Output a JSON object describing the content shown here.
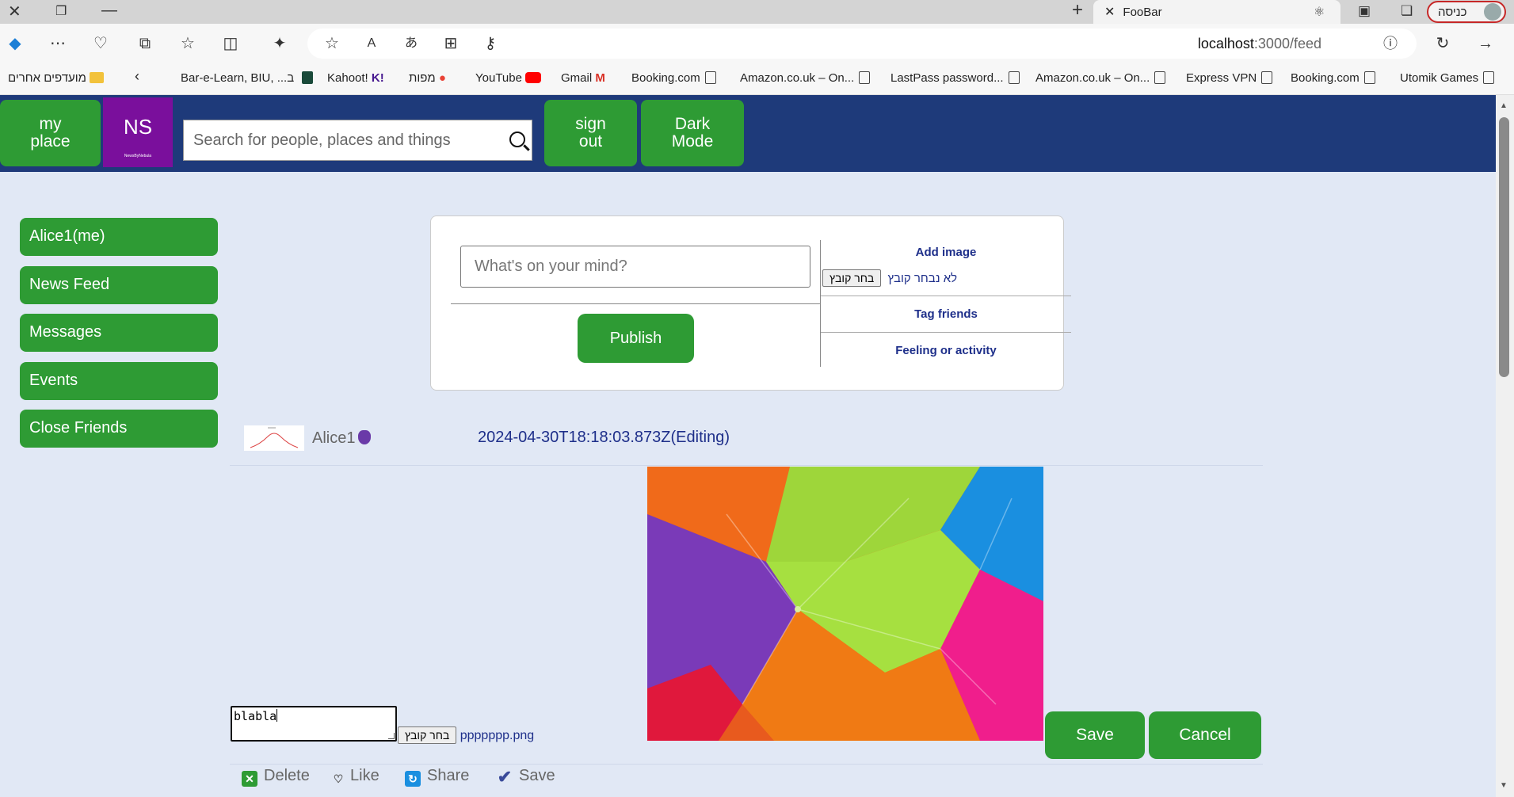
{
  "browser": {
    "tab_title": "FooBar",
    "profile_label": "כניסה",
    "url_host": "localhost",
    "url_port_path": ":3000/feed",
    "bookmarks": [
      "מועדפים אחרים",
      "Bar-e-Learn, BIU, ...ב",
      "Kahoot!",
      "מפות",
      "YouTube",
      "Gmail",
      "Booking.com",
      "Amazon.co.uk – On...",
      "LastPass password...",
      "Amazon.co.uk – On...",
      "Express VPN",
      "Booking.com",
      "Utomik Games"
    ]
  },
  "header": {
    "my_place": "my place",
    "logo_text": "NS",
    "logo_small": "NewsByNebula",
    "search_placeholder": "Search for people, places and things",
    "sign_out": "sign out",
    "dark_mode": "Dark Mode"
  },
  "sidebar": {
    "items": [
      {
        "label": "Alice1(me)"
      },
      {
        "label": "News Feed"
      },
      {
        "label": "Messages"
      },
      {
        "label": "Events"
      },
      {
        "label": "Close Friends"
      }
    ]
  },
  "composer": {
    "placeholder": "What's on your mind?",
    "publish": "Publish",
    "add_image": "Add image",
    "choose_file": "בחר קובץ",
    "no_file": "לא נבחר קובץ",
    "tag_friends": "Tag friends",
    "feeling": "Feeling or activity"
  },
  "post": {
    "author": "Alice1",
    "timestamp": "2024-04-30T18:18:03.873Z(Editing)",
    "edit_text": "blabla",
    "choose_file": "בחר קובץ",
    "file_name": "ppppppp.png",
    "save": "Save",
    "cancel": "Cancel",
    "actions": {
      "delete": "Delete",
      "like": "Like",
      "share": "Share",
      "save": "Save"
    }
  },
  "colors": {
    "header_bg": "#1e3a7a",
    "button_green": "#2e9b34",
    "page_bg": "#e1e8f5",
    "link_blue": "#1e2f8a"
  }
}
